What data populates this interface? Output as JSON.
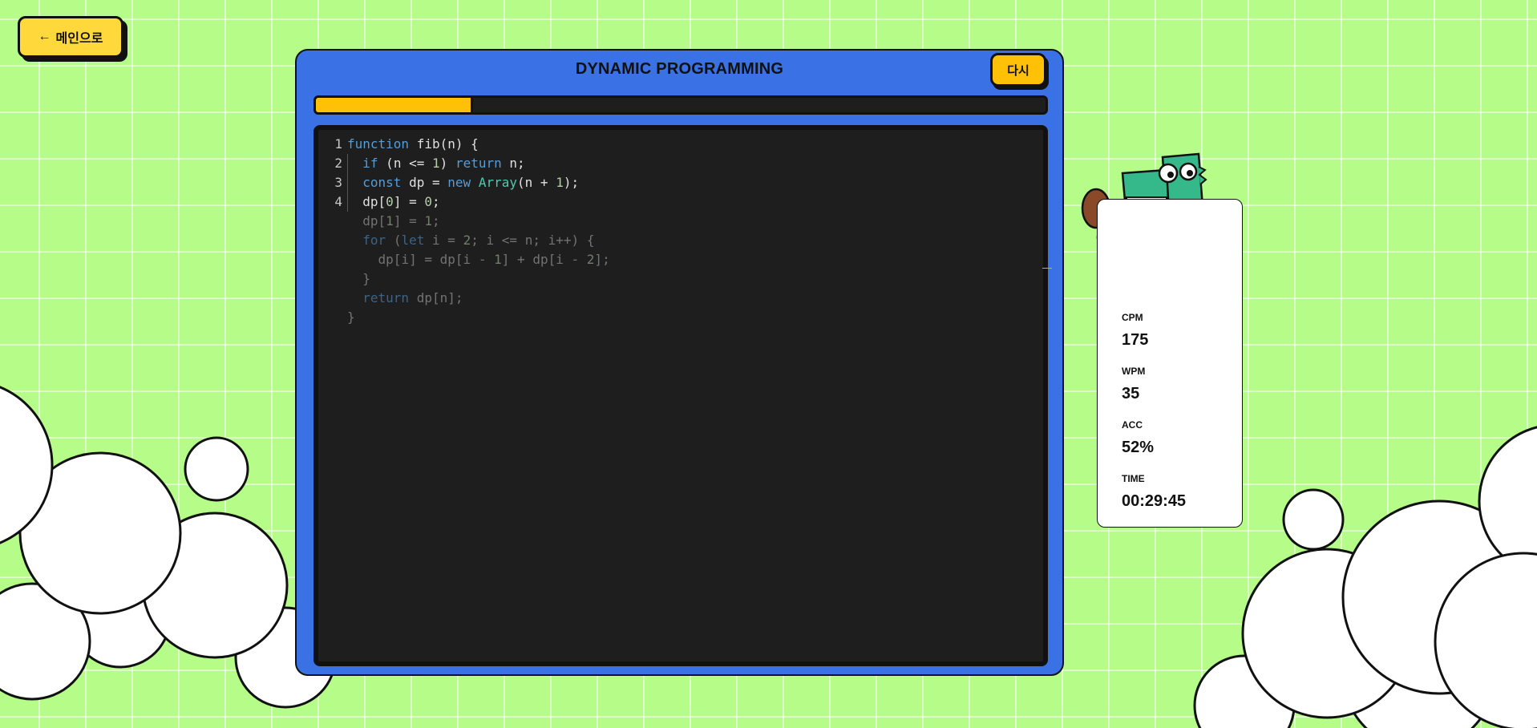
{
  "nav": {
    "back_label": "메인으로",
    "back_icon": "arrow-left-icon"
  },
  "panel": {
    "title": "DYNAMIC PROGRAMMING",
    "retry_label": "다시",
    "progress_fraction": 0.215
  },
  "editor": {
    "line_numbers": [
      "1",
      "2",
      "3",
      "4"
    ],
    "typed_lines": 4,
    "lines": [
      "function fib(n) {",
      "  if (n <= 1) return n;",
      "  const dp = new Array(n + 1);",
      "  dp[0] = 0;",
      "  dp[1] = 1;",
      "  for (let i = 2; i <= n; i++) {",
      "    dp[i] = dp[i - 1] + dp[i - 2];",
      "  }",
      "  return dp[n];",
      "}"
    ]
  },
  "stats": [
    {
      "label": "CPM",
      "value": "175"
    },
    {
      "label": "WPM",
      "value": "35"
    },
    {
      "label": "ACC",
      "value": "52%"
    },
    {
      "label": "TIME",
      "value": "00:29:45"
    }
  ],
  "colors": {
    "background": "#b5fc88",
    "panel": "#3a72e6",
    "accent_yellow": "#ffc107",
    "editor_bg": "#1e1e1e",
    "keyword": "#569cd6",
    "type": "#4ec9b0",
    "number": "#b5cea8"
  }
}
